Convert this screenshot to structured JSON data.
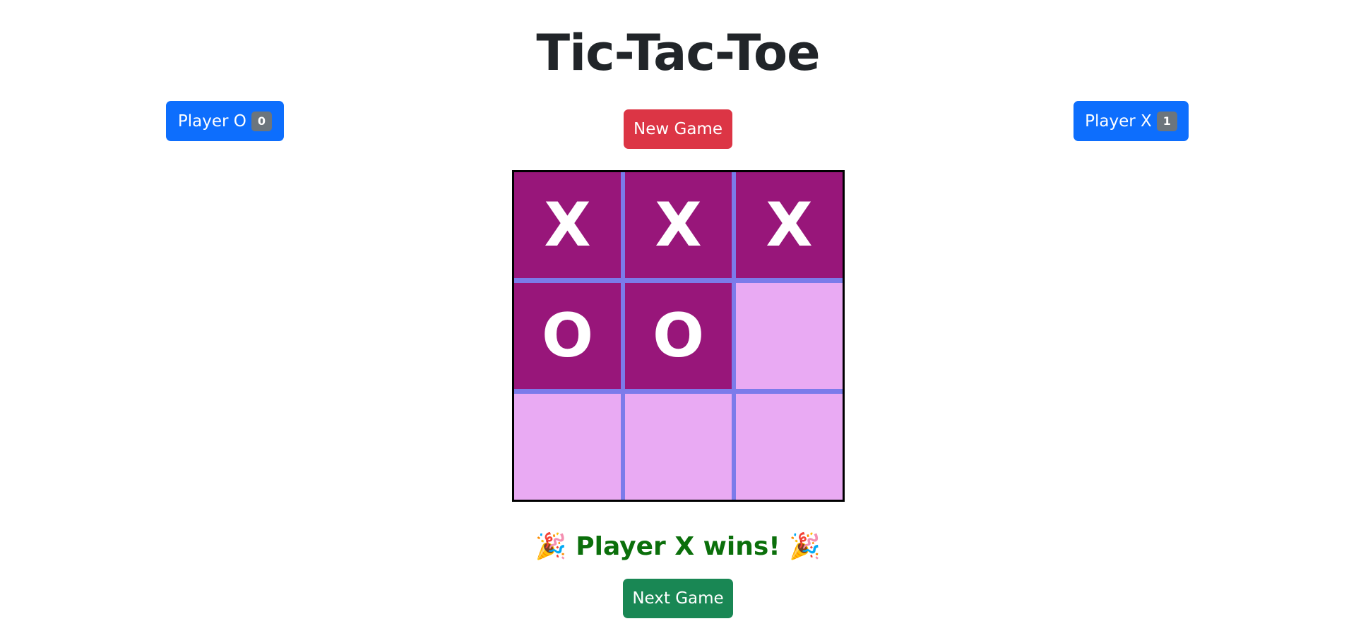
{
  "title": "Tic-Tac-Toe",
  "scores": {
    "player_o": {
      "label": "Player O",
      "score": "0"
    },
    "player_x": {
      "label": "Player X",
      "score": "1"
    }
  },
  "controls": {
    "new_game_label": "New Game",
    "next_game_label": "Next Game"
  },
  "board": {
    "cells": [
      "X",
      "X",
      "X",
      "O",
      "O",
      "",
      "",
      "",
      ""
    ]
  },
  "status": {
    "message": "Player X wins!",
    "emoji_left": "🎉",
    "emoji_right": "🎉"
  },
  "colors": {
    "primary": "#0d6efd",
    "danger": "#dc3545",
    "success": "#198754",
    "cell_filled": "#98167a",
    "cell_empty": "#e9aaf3",
    "grid_lines": "#7b7bea",
    "status_text": "#0b6f0b"
  }
}
